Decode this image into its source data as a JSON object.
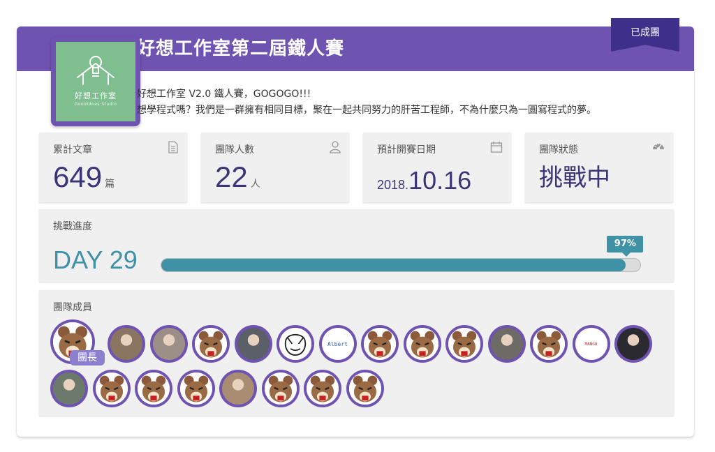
{
  "team": {
    "title": "好想工作室第二屆鐵人賽",
    "status_ribbon": "已成團",
    "logo_text": "好想工作室",
    "logo_subtext": "GoodIdeas·Studio",
    "description_line1": "好想工作室 V2.0 鐵人賽，GOGOGO!!!",
    "description_line2": "想學程式嗎？我們是一群擁有相同目標，聚在一起共同努力的肝苦工程師，不為什麼只為一圓寫程式的夢。"
  },
  "stats": {
    "articles": {
      "label": "累計文章",
      "value": "649",
      "unit": "篇",
      "icon": "document-icon"
    },
    "members": {
      "label": "團隊人數",
      "value": "22",
      "unit": "人",
      "icon": "user-icon"
    },
    "start_date": {
      "label": "預計開賽日期",
      "year": "2018.",
      "monthday": "10.16",
      "icon": "calendar-icon"
    },
    "status": {
      "label": "團隊狀態",
      "value": "挑戰中",
      "icon": "dashboard-icon"
    }
  },
  "progress": {
    "label": "挑戰進度",
    "day": "DAY 29",
    "percent_label": "97%",
    "percent": 97
  },
  "members_section": {
    "label": "團隊成員",
    "leader_tag": "團長",
    "avatars": [
      {
        "kind": "bear",
        "leader": true
      },
      {
        "kind": "photo",
        "color": "#8a7560"
      },
      {
        "kind": "photo",
        "color": "#9c8f88"
      },
      {
        "kind": "bear"
      },
      {
        "kind": "photo",
        "color": "#5a5f68"
      },
      {
        "kind": "sketch"
      },
      {
        "kind": "text",
        "text": "Albert"
      },
      {
        "kind": "bear"
      },
      {
        "kind": "bear"
      },
      {
        "kind": "bear"
      },
      {
        "kind": "photo",
        "color": "#6e6a66"
      },
      {
        "kind": "bear"
      },
      {
        "kind": "logo",
        "text": "MANGO"
      },
      {
        "kind": "photo",
        "color": "#2b2a30"
      },
      {
        "kind": "photo",
        "color": "#6b7a6a"
      },
      {
        "kind": "bear"
      },
      {
        "kind": "bear"
      },
      {
        "kind": "bear"
      },
      {
        "kind": "photo",
        "color": "#a88d72"
      },
      {
        "kind": "bear"
      },
      {
        "kind": "bear"
      },
      {
        "kind": "bear"
      }
    ]
  },
  "colors": {
    "brand_purple": "#6f53b1",
    "ribbon": "#3e2f8a",
    "teal": "#3f91a6",
    "number_navy": "#3a3577"
  }
}
